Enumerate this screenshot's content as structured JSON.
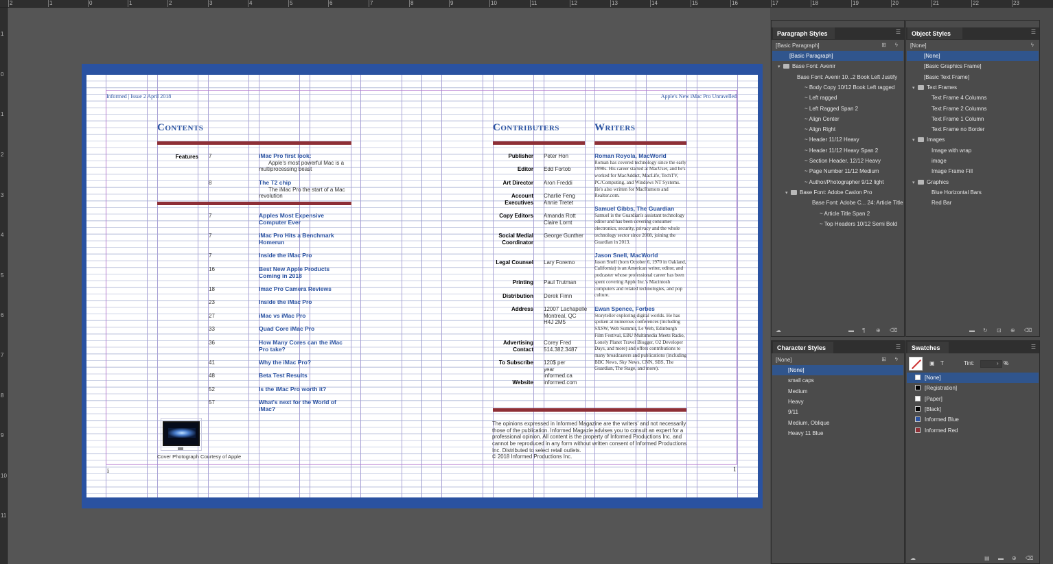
{
  "rulers": {
    "top": [
      "2",
      "1",
      "0",
      "1",
      "2",
      "3",
      "4",
      "5",
      "6",
      "7",
      "8",
      "9",
      "10",
      "11",
      "12",
      "13",
      "14",
      "15",
      "16",
      "17",
      "18",
      "19",
      "20",
      "21",
      "22",
      "23"
    ],
    "left": [
      "1",
      "0",
      "1",
      "2",
      "3",
      "4",
      "5",
      "6",
      "7",
      "8",
      "9",
      "10",
      "11"
    ]
  },
  "document": {
    "folio_left": "Informed | Issue 2 April 2018",
    "folio_right": "Apple's New iMac Pro Unravelled",
    "contents_title": "Contents",
    "contributors_title": "Contributers",
    "writers_title": "Writers",
    "features_label": "Features",
    "page_num_left": "i",
    "page_num_right": "1",
    "cover_caption": "Cover Photograph Courtesy of Apple",
    "contents": [
      {
        "page": "7",
        "title": "iMac Pro first look:",
        "desc": "Apple's most powerful Mac is a multiprocessing beast"
      },
      {
        "page": "8",
        "title": "The T2 chip",
        "desc": "The iMac Pro the start of a Mac revolution"
      },
      {
        "page": "7",
        "title": "Apples Most Expensive Computer Ever",
        "desc": ""
      },
      {
        "page": "7",
        "title": "iMac Pro Hits a Benchmark Homerun",
        "desc": ""
      },
      {
        "page": "7",
        "title": "Inside the iMac Pro",
        "desc": ""
      },
      {
        "page": "16",
        "title": "Best New Apple Products Coming in 2018",
        "desc": ""
      },
      {
        "page": "18",
        "title": "Imac Pro Camera Reviews",
        "desc": ""
      },
      {
        "page": "23",
        "title": "Inside the iMac Pro",
        "desc": ""
      },
      {
        "page": "27",
        "title": "iMac vs iMac Pro",
        "desc": ""
      },
      {
        "page": "33",
        "title": "Quad Core iMac Pro",
        "desc": ""
      },
      {
        "page": "36",
        "title": "How Many Cores can the iMac Pro take?",
        "desc": ""
      },
      {
        "page": "41",
        "title": "Why the iMac Pro?",
        "desc": ""
      },
      {
        "page": "48",
        "title": "Beta Test Results",
        "desc": ""
      },
      {
        "page": "52",
        "title": "Is the iMac Pro worth it?",
        "desc": ""
      },
      {
        "page": "57",
        "title": "What's next for the World of iMac?",
        "desc": ""
      }
    ],
    "contributors": [
      {
        "label": "Publisher",
        "value": "Peter Hon"
      },
      {
        "label": "Editor",
        "value": "Edd Fortob"
      },
      {
        "label": "Art Director",
        "value": "Aron Freddi"
      },
      {
        "label": "Account Executives",
        "value": "Charlie Feng Annie Tretet"
      },
      {
        "label": "Copy Editors",
        "value": "Amanda Rott Claire Lornt"
      },
      {
        "label": "Social Medial Coordinator",
        "value": "George Gunther"
      },
      {
        "label": "Legal Counsel",
        "value": "Lary Foremo"
      },
      {
        "label": "Printing",
        "value": "Paul Trutman"
      },
      {
        "label": "Distribution",
        "value": "Derek Fimn"
      },
      {
        "label": "Address",
        "value": "12007 Lachapelle Montreal, QC H4J 2M5"
      },
      {
        "label": "Advertising Contact",
        "value": "Corey Fred 514.382.3487"
      },
      {
        "label": "To Subscribe",
        "value": "120$ per year informed.ca"
      },
      {
        "label": "Website",
        "value": "informed.com"
      }
    ],
    "writers": [
      {
        "name": "Roman Royola, MacWorld",
        "bio": "Roman has covered technology since the early 1990s. His career started at MacUser, and he's worked for MacAddict, MacLife, TechTV, PC/Computing, and Windows NT Systems. He's also written for MacRumors and Realtor.com."
      },
      {
        "name": "Samuel Gibbs, The Guardian",
        "bio": "Samuel is the Guardian's assistant technology editor and has been covering consumer electronics, security, privacy and the whole technology sector since 2008, joining the Guardian in 2013."
      },
      {
        "name": "Jason Snell, MacWorld",
        "bio": "Jason Snell (born October 6, 1970 in Oakland, California) is an American writer, editor, and podcaster whose professional career has been spent covering Apple Inc.'s Macintosh computers and related technologies, and pop culture."
      },
      {
        "name": "Ewan Spence, Forbes",
        "bio": "Storyteller exploring digital worlds. He has spoken at numerous conferences (including SXSW, Web Summit, Le Web, Edinburgh Film Festival, EBU Multimedia Meets Radio, Lonely Planet Travel Blogger, O2 Developer Days, and more) and offers contributions to many broadcasters and publications (including BBC News, Sky News, CNN, SBS, The Guardian, The Stage, and more)."
      }
    ],
    "disclaimer": "The opinions expressed in Informed Magazine are the writers' and not necessarily those of the publication. Informed Magazie advises you to consult an expert for a professional opinion. All content is the property of Informed Productions Inc. and cannot be reproduced in any form without written consent of Informed Productions Inc. Distributed to select retail outlets.",
    "copyright": "© 2018 Informed Productions Inc."
  },
  "paragraph_styles": {
    "tab": "Paragraph Styles",
    "current": "[Basic Paragraph]",
    "items": [
      {
        "label": "[Basic Paragraph]",
        "indent": 1,
        "type": "item",
        "selected": true
      },
      {
        "label": "Base Font: Avenir",
        "indent": 0,
        "type": "group"
      },
      {
        "label": "Base Font: Avenir 10...2 Book Left Justify",
        "indent": 2,
        "type": "item"
      },
      {
        "label": "~ Body Copy 10/12 Book Left ragged",
        "indent": 3,
        "type": "item"
      },
      {
        "label": "~ Left ragged",
        "indent": 3,
        "type": "item"
      },
      {
        "label": "~ Left Ragged Span 2",
        "indent": 3,
        "type": "item"
      },
      {
        "label": "~ Align Center",
        "indent": 3,
        "type": "item"
      },
      {
        "label": "~ Align Right",
        "indent": 3,
        "type": "item"
      },
      {
        "label": "~ Header 11/12 Heavy",
        "indent": 3,
        "type": "item"
      },
      {
        "label": "~ Header 11/12 Heavy Span 2",
        "indent": 3,
        "type": "item"
      },
      {
        "label": "~ Section Header. 12/12 Heavy",
        "indent": 3,
        "type": "item"
      },
      {
        "label": "~ Page Number 11/12 Medium",
        "indent": 3,
        "type": "item"
      },
      {
        "label": "~ Author/Photographer 9/12 light",
        "indent": 3,
        "type": "item"
      },
      {
        "label": "Base Font: Adobe Caslon Pro",
        "indent": 1,
        "type": "group"
      },
      {
        "label": "Base Font: Adobe C... 24: Article Title",
        "indent": 4,
        "type": "item"
      },
      {
        "label": "~ Article Title Span 2",
        "indent": 5,
        "type": "item"
      },
      {
        "label": "~ Top Headers 10/12 Semi Bold",
        "indent": 5,
        "type": "item"
      }
    ]
  },
  "object_styles": {
    "tab": "Object Styles",
    "current": "[None]",
    "items": [
      {
        "label": "[None]",
        "indent": 1,
        "type": "item",
        "selected": true
      },
      {
        "label": "[Basic Graphics Frame]",
        "indent": 1,
        "type": "item"
      },
      {
        "label": "[Basic Text Frame]",
        "indent": 1,
        "type": "item"
      },
      {
        "label": "Text Frames",
        "indent": 0,
        "type": "group"
      },
      {
        "label": "Text Frame 4 Columns",
        "indent": 2,
        "type": "item"
      },
      {
        "label": "Text Frame 2 Columns",
        "indent": 2,
        "type": "item"
      },
      {
        "label": "Text Frame 1 Column",
        "indent": 2,
        "type": "item"
      },
      {
        "label": "Text Frame no Border",
        "indent": 2,
        "type": "item"
      },
      {
        "label": "Images",
        "indent": 0,
        "type": "group"
      },
      {
        "label": "Image with wrap",
        "indent": 2,
        "type": "item"
      },
      {
        "label": "image",
        "indent": 2,
        "type": "item"
      },
      {
        "label": "Image Frame Fill",
        "indent": 2,
        "type": "item"
      },
      {
        "label": "Graphics",
        "indent": 0,
        "type": "group"
      },
      {
        "label": "Blue Horizontal Bars",
        "indent": 2,
        "type": "item"
      },
      {
        "label": "Red Bar",
        "indent": 2,
        "type": "item"
      }
    ]
  },
  "character_styles": {
    "tab": "Character Styles",
    "current": "[None]",
    "items": [
      {
        "label": "[None]",
        "selected": true
      },
      {
        "label": "small caps"
      },
      {
        "label": "Medium"
      },
      {
        "label": "Heavy"
      },
      {
        "label": "9/11"
      },
      {
        "label": "Medium, Oblique"
      },
      {
        "label": "Heavy 11 Blue"
      }
    ]
  },
  "swatches": {
    "tab": "Swatches",
    "tint_label": "Tint:",
    "tint_suffix": "%",
    "items": [
      {
        "label": "[None]",
        "color": "#ffffff",
        "selected": true
      },
      {
        "label": "[Registration]",
        "color": "#000000"
      },
      {
        "label": "[Paper]",
        "color": "#ffffff"
      },
      {
        "label": "[Black]",
        "color": "#000000"
      },
      {
        "label": "Informed Blue",
        "color": "#2a52a1"
      },
      {
        "label": "Informed Red",
        "color": "#8e2f36"
      }
    ]
  },
  "colors": {
    "informed_blue": "#2a52a1",
    "informed_red": "#8e2f36",
    "selection": "#30558d"
  }
}
